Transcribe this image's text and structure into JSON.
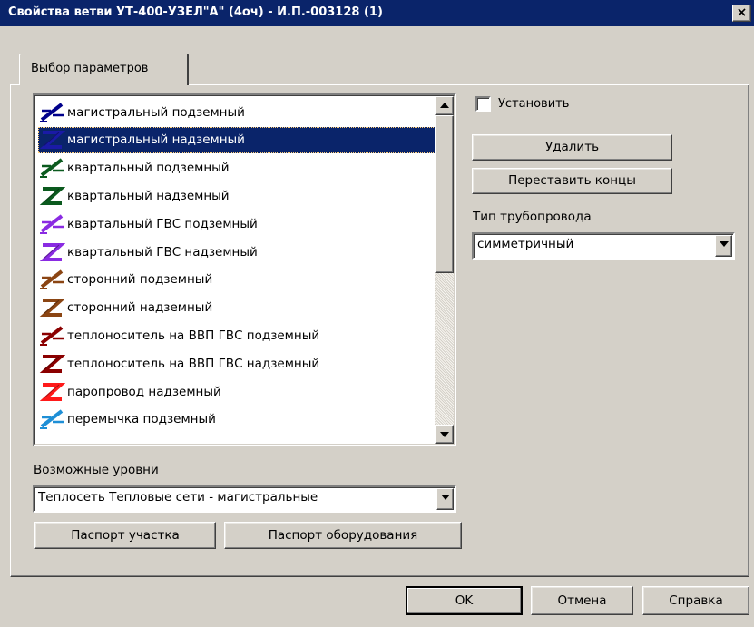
{
  "window": {
    "title": "Свойства ветви  УТ-400-УЗЕЛ\"А\" (4оч) - И.П.-003128 (1)",
    "close_glyph": "×"
  },
  "tab": {
    "label": "Выбор параметров"
  },
  "branch_list": {
    "selected_index": 1,
    "items": [
      {
        "label": "магистральный подземный",
        "icon": "pipe-underground-icon",
        "color": "#00008b"
      },
      {
        "label": "магистральный надземный",
        "icon": "pipe-overground-icon",
        "color": "#1a1aa6"
      },
      {
        "label": "квартальный подземный",
        "icon": "pipe-underground-icon",
        "color": "#0b5a1e"
      },
      {
        "label": "квартальный надземный",
        "icon": "pipe-overground-icon",
        "color": "#0b5a1e"
      },
      {
        "label": "квартальный ГВС подземный",
        "icon": "pipe-underground-icon",
        "color": "#8a2be2"
      },
      {
        "label": "квартальный ГВС надземный",
        "icon": "pipe-overground-icon",
        "color": "#8a2be2"
      },
      {
        "label": "сторонний подземный",
        "icon": "pipe-underground-icon",
        "color": "#8b4513"
      },
      {
        "label": "сторонний надземный",
        "icon": "pipe-overground-icon",
        "color": "#8b4513"
      },
      {
        "label": "теплоноситель на ВВП ГВС подземный",
        "icon": "pipe-underground-icon",
        "color": "#8b0000"
      },
      {
        "label": "теплоноситель на ВВП ГВС надземный",
        "icon": "pipe-overground-icon",
        "color": "#8b0000"
      },
      {
        "label": "паропровод надземный",
        "icon": "pipe-overground-icon",
        "color": "#ff1a1a"
      },
      {
        "label": "перемычка подземный",
        "icon": "pipe-underground-icon",
        "color": "#1e8fd6"
      }
    ]
  },
  "set_checkbox": {
    "label": "Установить",
    "checked": false
  },
  "buttons": {
    "delete": "Удалить",
    "swap_ends": "Переставить концы",
    "section_passport": "Паспорт участка",
    "equipment_passport": "Паспорт оборудования",
    "ok": "OK",
    "cancel": "Отмена",
    "help": "Справка"
  },
  "pipe_type": {
    "label": "Тип трубопровода",
    "value": "симметричный"
  },
  "levels": {
    "label": "Возможные уровни",
    "value": "Теплосеть Тепловые сети - магистральные"
  },
  "colors": {
    "titlebar": "#0a246a",
    "selection": "#0a246a",
    "face": "#d4d0c8"
  }
}
